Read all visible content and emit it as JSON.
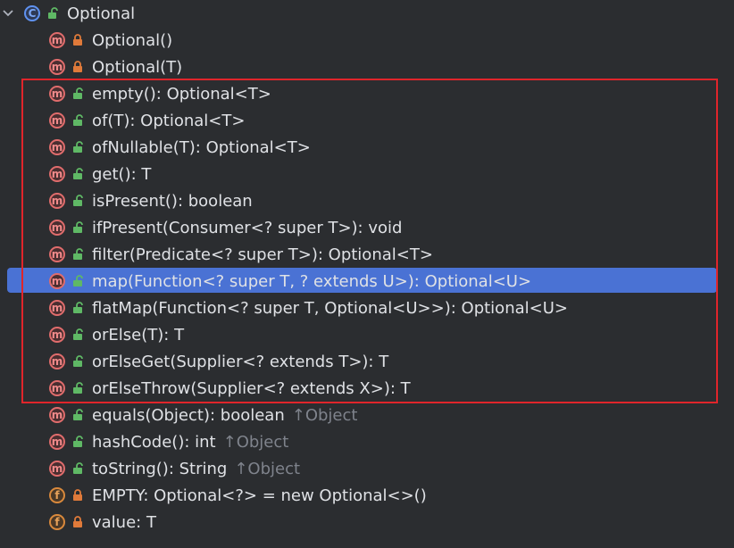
{
  "class_node": {
    "name": "Optional",
    "icon": "class-icon",
    "badge": "C",
    "expanded": true
  },
  "members": [
    {
      "badge": "m",
      "lock": "private",
      "label": "Optional()",
      "inherited": ""
    },
    {
      "badge": "m",
      "lock": "private",
      "label": "Optional(T)",
      "inherited": ""
    },
    {
      "badge": "m",
      "lock": "public",
      "label": "empty(): Optional<T>",
      "inherited": ""
    },
    {
      "badge": "m",
      "lock": "public",
      "label": "of(T): Optional<T>",
      "inherited": ""
    },
    {
      "badge": "m",
      "lock": "public",
      "label": "ofNullable(T): Optional<T>",
      "inherited": ""
    },
    {
      "badge": "m",
      "lock": "public",
      "label": "get(): T",
      "inherited": ""
    },
    {
      "badge": "m",
      "lock": "public",
      "label": "isPresent(): boolean",
      "inherited": ""
    },
    {
      "badge": "m",
      "lock": "public",
      "label": "ifPresent(Consumer<? super T>): void",
      "inherited": ""
    },
    {
      "badge": "m",
      "lock": "public",
      "label": "filter(Predicate<? super T>): Optional<T>",
      "inherited": ""
    },
    {
      "badge": "m",
      "lock": "public",
      "label": "map(Function<? super T, ? extends U>): Optional<U>",
      "inherited": "",
      "selected": true
    },
    {
      "badge": "m",
      "lock": "public",
      "label": "flatMap(Function<? super T, Optional<U>>): Optional<U>",
      "inherited": ""
    },
    {
      "badge": "m",
      "lock": "public",
      "label": "orElse(T): T",
      "inherited": ""
    },
    {
      "badge": "m",
      "lock": "public",
      "label": "orElseGet(Supplier<? extends T>): T",
      "inherited": ""
    },
    {
      "badge": "m",
      "lock": "public",
      "label": "orElseThrow(Supplier<? extends X>): T",
      "inherited": ""
    },
    {
      "badge": "m",
      "lock": "public",
      "label": "equals(Object): boolean",
      "inherited": "↑Object"
    },
    {
      "badge": "m",
      "lock": "public",
      "label": "hashCode(): int",
      "inherited": "↑Object"
    },
    {
      "badge": "m",
      "lock": "public",
      "label": "toString(): String",
      "inherited": "↑Object"
    },
    {
      "badge": "f",
      "lock": "private",
      "label": "EMPTY: Optional<?> = new Optional<>()",
      "inherited": ""
    },
    {
      "badge": "f",
      "lock": "private",
      "label": "value: T",
      "inherited": ""
    }
  ],
  "colors": {
    "background": "#2b2d30",
    "selection": "#4a72d4",
    "highlight_border": "#e0252b",
    "public_lock": "#5fb865",
    "private_lock": "#e07a3a"
  }
}
